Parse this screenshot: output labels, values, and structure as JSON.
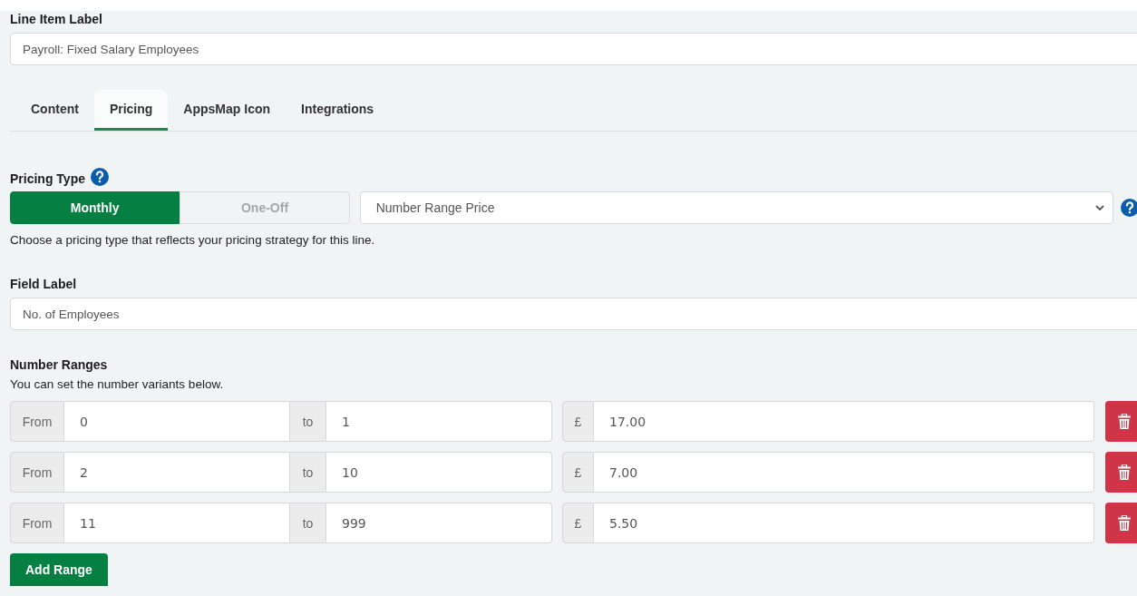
{
  "line_item_label": {
    "label": "Line Item Label",
    "value": "Payroll: Fixed Salary Employees"
  },
  "tabs": [
    {
      "label": "Content",
      "selected": false
    },
    {
      "label": "Pricing",
      "selected": true
    },
    {
      "label": "AppsMap Icon",
      "selected": false
    },
    {
      "label": "Integrations",
      "selected": false
    }
  ],
  "pricing_type": {
    "label": "Pricing Type",
    "options": [
      {
        "label": "Monthly",
        "selected": true
      },
      {
        "label": "One-Off",
        "selected": false
      }
    ],
    "select_value": "Number Range Price",
    "help": "Choose a pricing type that reflects your pricing strategy for this line."
  },
  "field_label": {
    "label": "Field Label",
    "value": "No. of Employees"
  },
  "number_ranges": {
    "title": "Number Ranges",
    "subtitle": "You can set the number variants below.",
    "rows": [
      {
        "from_label": "From",
        "from": "0",
        "to_label": "to",
        "to": "1",
        "currency": "£",
        "price": "17.00"
      },
      {
        "from_label": "From",
        "from": "2",
        "to_label": "to",
        "to": "10",
        "currency": "£",
        "price": "7.00"
      },
      {
        "from_label": "From",
        "from": "11",
        "to_label": "to",
        "to": "999",
        "currency": "£",
        "price": "5.50"
      }
    ]
  },
  "add_button": "Add Range"
}
